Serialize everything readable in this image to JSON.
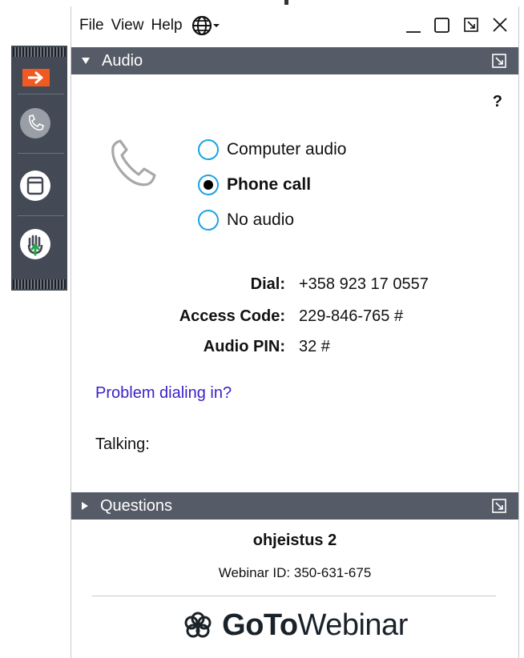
{
  "menubar": {
    "items": [
      "File",
      "View",
      "Help"
    ]
  },
  "audio_panel": {
    "title": "Audio",
    "help": "?",
    "options": [
      {
        "label": "Computer audio",
        "selected": false
      },
      {
        "label": "Phone call",
        "selected": true
      },
      {
        "label": "No audio",
        "selected": false
      }
    ],
    "dial_label": "Dial:",
    "dial_value": "+358 923 17 0557",
    "access_label": "Access Code:",
    "access_value": "229-846-765 #",
    "pin_label": "Audio PIN:",
    "pin_value": "32 #",
    "problem_link": "Problem dialing in?",
    "talking_label": "Talking:"
  },
  "questions_panel": {
    "title": "Questions"
  },
  "webinar": {
    "name": "ohjeistus 2",
    "id_text": "Webinar ID: 350-631-675"
  },
  "brand": {
    "bold": "GoTo",
    "regular": "Webinar"
  },
  "colors": {
    "accent_orange": "#f05a22",
    "header_bg": "#555b67",
    "radio_blue": "#1aa3e2",
    "link": "#3a22c9"
  }
}
